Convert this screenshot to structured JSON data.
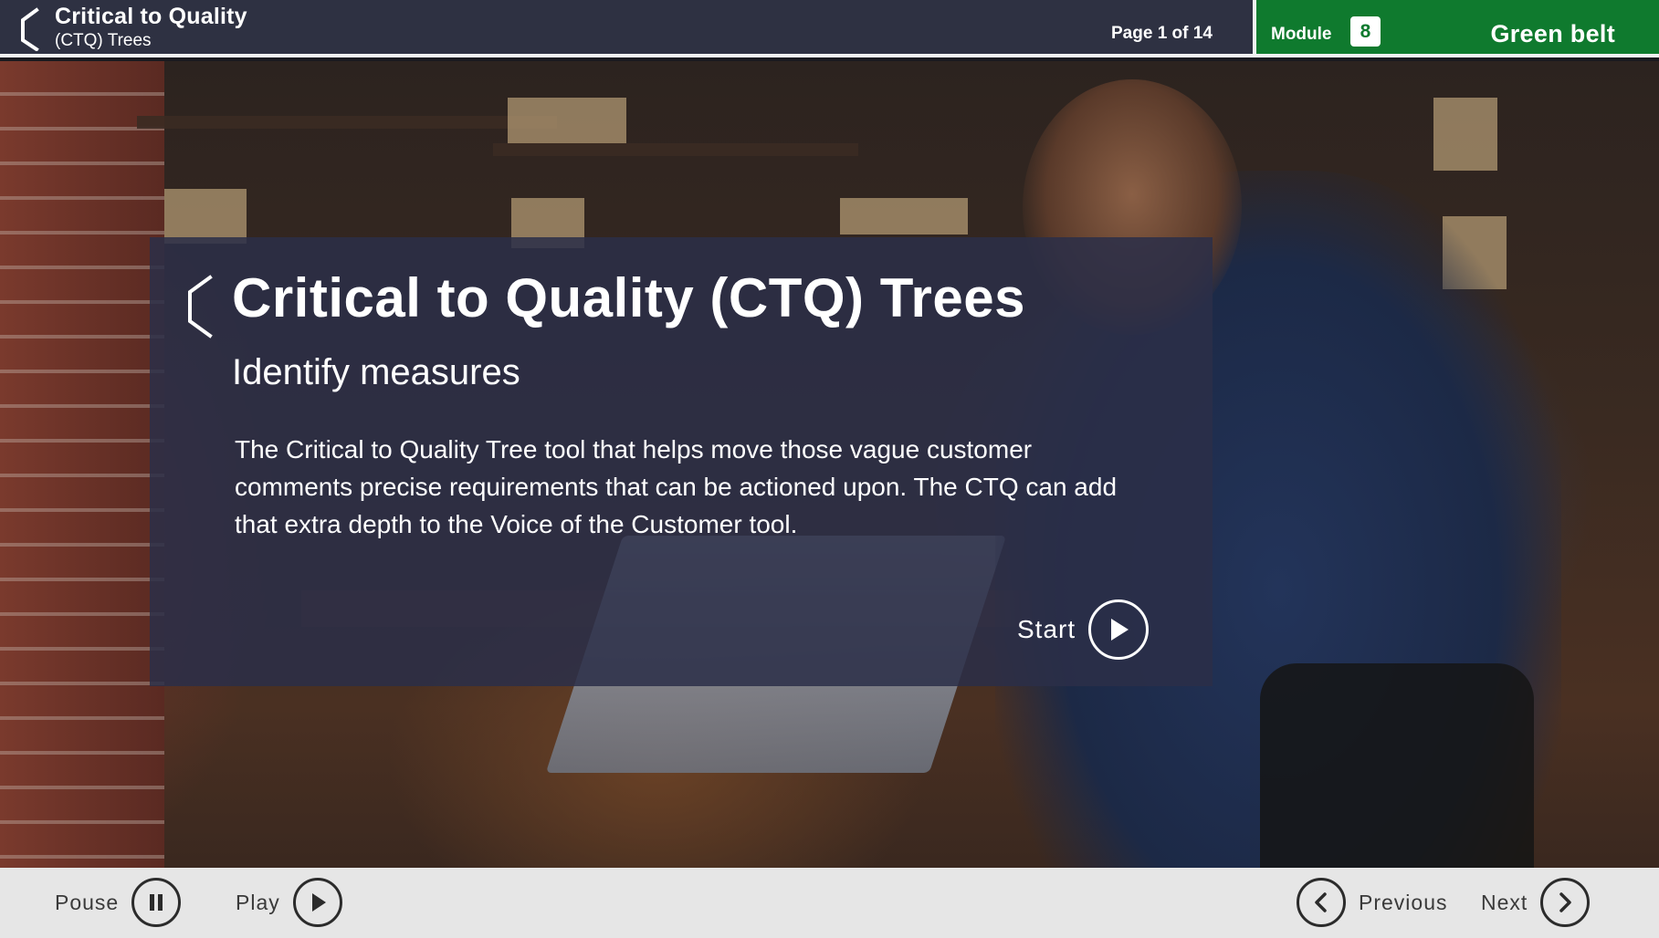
{
  "header": {
    "title_line1": "Critical to Quality",
    "title_line2": "(CTQ) Trees",
    "page_indicator": "Page 1 of 14",
    "back_icon": "bracket-back-icon"
  },
  "module": {
    "label": "Module",
    "number": "8",
    "level": "Green belt"
  },
  "intro": {
    "title": "Critical to Quality (CTQ) Trees",
    "subtitle": "Identify measures",
    "body": "The Critical to Quality Tree tool that helps move those vague customer comments precise requirements that can be actioned upon. The CTQ can add that extra depth to the Voice of the Customer tool.",
    "start_label": "Start",
    "start_icon": "play-icon"
  },
  "footer": {
    "pause_label": "Pouse",
    "pause_icon": "pause-icon",
    "play_label": "Play",
    "play_icon": "play-icon",
    "previous_label": "Previous",
    "previous_icon": "chevron-left-icon",
    "next_label": "Next",
    "next_icon": "chevron-right-icon"
  },
  "colors": {
    "header_bg": "#2e3142",
    "module_bg": "#0f7a2e",
    "card_bg": "#2b2e48",
    "footer_bg": "#e6e6e6"
  }
}
